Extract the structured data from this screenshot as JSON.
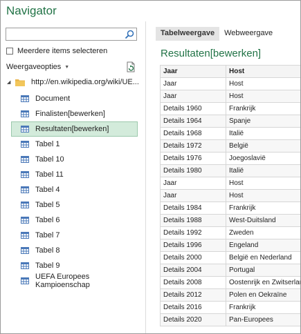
{
  "window": {
    "title": "Navigator"
  },
  "search": {
    "placeholder": "",
    "value": ""
  },
  "multi_select": {
    "label": "Meerdere items selecteren",
    "checked": false
  },
  "options": {
    "label": "Weergaveopties"
  },
  "tree": {
    "root_label": "http://en.wikipedia.org/wiki/UE...",
    "items": [
      {
        "label": "Document",
        "selected": false
      },
      {
        "label": "Finalisten[bewerken]",
        "selected": false
      },
      {
        "label": "Resultaten[bewerken]",
        "selected": true
      },
      {
        "label": "Tabel 1",
        "selected": false
      },
      {
        "label": "Tabel 10",
        "selected": false
      },
      {
        "label": "Tabel 11",
        "selected": false
      },
      {
        "label": "Tabel 4",
        "selected": false
      },
      {
        "label": "Tabel 5",
        "selected": false
      },
      {
        "label": "Tabel 6",
        "selected": false
      },
      {
        "label": "Tabel 7",
        "selected": false
      },
      {
        "label": "Tabel 8",
        "selected": false
      },
      {
        "label": "Tabel 9",
        "selected": false
      },
      {
        "label": "UEFA Europees Kampioenschap",
        "selected": false
      }
    ]
  },
  "tabs": [
    {
      "label": "Tabelweergave",
      "active": true
    },
    {
      "label": "Webweergave",
      "active": false
    }
  ],
  "preview": {
    "title": "Resultaten[bewerken]",
    "columns": [
      "Jaar",
      "Host"
    ],
    "rows": [
      [
        "Jaar",
        "Host"
      ],
      [
        "Jaar",
        "Host"
      ],
      [
        "Details 1960",
        "Frankrijk"
      ],
      [
        "Details 1964",
        "Spanje"
      ],
      [
        "Details 1968",
        "Italië"
      ],
      [
        "Details 1972",
        "België"
      ],
      [
        "Details 1976",
        "Joegoslavië"
      ],
      [
        "Details 1980",
        "Italië"
      ],
      [
        "Jaar",
        "Host"
      ],
      [
        "Jaar",
        "Host"
      ],
      [
        "Details 1984",
        "Frankrijk"
      ],
      [
        "Details 1988",
        "West-Duitsland"
      ],
      [
        "Details 1992",
        "Zweden"
      ],
      [
        "Details 1996",
        "Engeland"
      ],
      [
        "Details 2000",
        "België en Nederland"
      ],
      [
        "Details 2004",
        "Portugal"
      ],
      [
        "Details 2008",
        "Oostenrijk en Zwitserland"
      ],
      [
        "Details 2012",
        "Polen en Oekraïne"
      ],
      [
        "Details 2016",
        "Frankrijk"
      ],
      [
        "Details 2020",
        "Pan-Europees"
      ]
    ]
  },
  "colors": {
    "accent": "#217346",
    "selected_bg": "#d3ebdb"
  }
}
